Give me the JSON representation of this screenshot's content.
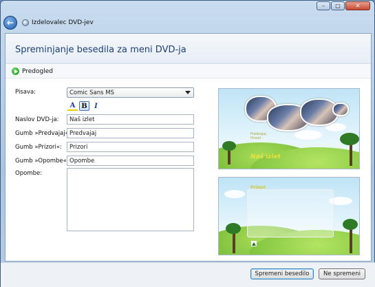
{
  "window": {
    "title": "Izdelovalec DVD-jev",
    "controls": {
      "minimize": "–",
      "maximize": "□",
      "close": "✕"
    }
  },
  "header": {
    "title": "Spreminjanje besedila za meni DVD-ja"
  },
  "toolbar": {
    "preview_label": "Predogled"
  },
  "form": {
    "font_label": "Pisava:",
    "font_value": "Comic Sans MS",
    "format": {
      "color_glyph": "A",
      "bold_glyph": "B",
      "italic_glyph": "I"
    },
    "dvd_title_label": "Naslov DVD-ja:",
    "dvd_title_value": "Naš izlet",
    "play_label": "Gumb »Predvajaj«:",
    "play_value": "Predvajaj",
    "scenes_label": "Gumb »Prizori«:",
    "scenes_value": "Prizori",
    "notes_button_label": "Gumb »Opombe«:",
    "notes_button_value": "Opombe",
    "notes_label": "Opombe:",
    "notes_value": ""
  },
  "preview": {
    "menu_title": "Naš izlet",
    "menu_buttons": "Predvajaj\nPrizori",
    "scenes_title": "Prizori"
  },
  "footer": {
    "apply_label": "Spremeni besedilo",
    "cancel_label": "Ne spremeni"
  }
}
